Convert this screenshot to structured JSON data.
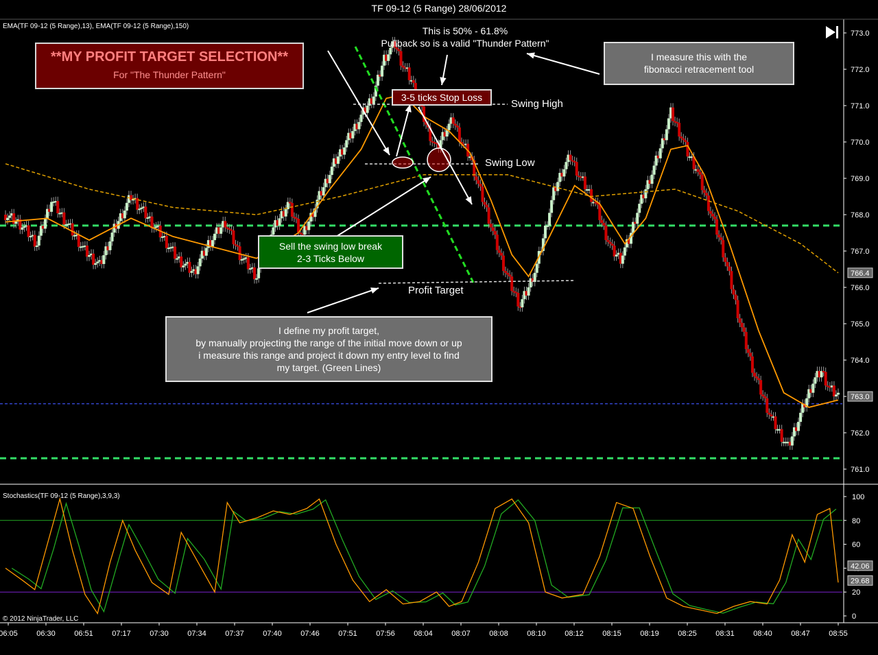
{
  "window": {
    "title": "TF 09-12 (5 Range)  28/06/2012"
  },
  "price_panel": {
    "indicator_label": "EMA(TF 09-12 (5 Range),13), EMA(TF 09-12 (5 Range),150)",
    "price_labels": [
      "773.0",
      "772.0",
      "771.0",
      "770.0",
      "769.0",
      "768.0",
      "767.0",
      "766.0",
      "765.0",
      "764.0",
      "763.0",
      "762.0",
      "761.0"
    ],
    "last_price_tag": "766.4",
    "line_price_tag": "763.0"
  },
  "stoch_panel": {
    "indicator_label": "Stochastics(TF 09-12 (5 Range),3,9,3)",
    "levels": [
      "100",
      "80",
      "60",
      "40",
      "20",
      "0"
    ],
    "tag_k": "42.06",
    "tag_d": "29.68"
  },
  "x_axis": {
    "ticks": [
      "06:05",
      "06:30",
      "06:51",
      "07:17",
      "07:30",
      "07:34",
      "07:37",
      "07:40",
      "07:46",
      "07:51",
      "07:56",
      "08:04",
      "08:07",
      "08:08",
      "08:10",
      "08:12",
      "08:15",
      "08:19",
      "08:25",
      "08:31",
      "08:40",
      "08:47",
      "08:55"
    ]
  },
  "copyright": "© 2012 NinjaTrader, LLC",
  "annotations": {
    "title_box": {
      "title": "**MY PROFIT TARGET SELECTION**",
      "subtitle": "For \"The Thunder Pattern\""
    },
    "pullback": {
      "line1": "This is 50% - 61.8%",
      "line2": "Pullback so is a valid \"Thunder Pattern\""
    },
    "fib_box": {
      "line1": "I measure this with the",
      "line2": "fibonacci retracement tool"
    },
    "stop_loss": "3-5 ticks Stop Loss",
    "swing_high": "Swing High",
    "swing_low": "Swing Low",
    "sell_box": {
      "line1": "Sell the swing low break",
      "line2": "2-3 Ticks Below"
    },
    "profit_target": "Profit Target",
    "define_box": {
      "line1": "I define my profit target,",
      "line2": "by manually projecting the range of the initial move down or up",
      "line3": "i measure this range and project it down my entry level to find",
      "line4": "my target. (Green Lines)"
    }
  },
  "colors": {
    "background": "#000000",
    "candle_up": "#c8f0c8",
    "candle_down": "#cc0000",
    "ema13": "#ff9900",
    "ema150": "#e0a000",
    "green_lines": "#33dd66",
    "blue_line": "#3344cc",
    "stoch_k": "#ff9900",
    "stoch_d": "#22aa22",
    "title_box_bg": "#6b0000",
    "sell_box_bg": "#006600",
    "grey_box_bg": "#6e6e6e"
  },
  "chart_data": {
    "type": "candlestick",
    "title": "TF 09-12 (5 Range)  28/06/2012",
    "ylim": [
      760.8,
      773.3
    ],
    "y_ticks": [
      773,
      772,
      771,
      770,
      769,
      768,
      767,
      766,
      765,
      764,
      763,
      762,
      761
    ],
    "x_ticks": [
      "06:05",
      "06:30",
      "06:51",
      "07:17",
      "07:30",
      "07:34",
      "07:37",
      "07:40",
      "07:46",
      "07:51",
      "07:56",
      "08:04",
      "08:07",
      "08:08",
      "08:10",
      "08:12",
      "08:15",
      "08:19",
      "08:25",
      "08:31",
      "08:40",
      "08:47",
      "08:55"
    ],
    "close_path": [
      [
        0,
        768.0
      ],
      [
        8,
        767.7
      ],
      [
        15,
        767.2
      ],
      [
        22,
        768.4
      ],
      [
        30,
        767.7
      ],
      [
        38,
        767.0
      ],
      [
        45,
        766.6
      ],
      [
        52,
        767.6
      ],
      [
        60,
        768.5
      ],
      [
        67,
        768.0
      ],
      [
        75,
        767.4
      ],
      [
        82,
        766.8
      ],
      [
        90,
        766.4
      ],
      [
        97,
        767.2
      ],
      [
        105,
        767.8
      ],
      [
        112,
        766.9
      ],
      [
        120,
        766.3
      ],
      [
        127,
        767.5
      ],
      [
        135,
        768.3
      ],
      [
        142,
        767.4
      ],
      [
        150,
        768.5
      ],
      [
        157,
        769.4
      ],
      [
        164,
        770.1
      ],
      [
        170,
        770.7
      ],
      [
        176,
        771.3
      ],
      [
        181,
        772.3
      ],
      [
        186,
        772.7
      ],
      [
        190,
        772.1
      ],
      [
        194,
        771.7
      ],
      [
        198,
        771.0
      ],
      [
        202,
        770.3
      ],
      [
        206,
        769.8
      ],
      [
        210,
        770.3
      ],
      [
        214,
        770.6
      ],
      [
        218,
        770.0
      ],
      [
        222,
        769.6
      ],
      [
        226,
        768.8
      ],
      [
        230,
        768.1
      ],
      [
        234,
        767.3
      ],
      [
        238,
        766.6
      ],
      [
        242,
        766.0
      ],
      [
        246,
        765.5
      ],
      [
        250,
        766.0
      ],
      [
        254,
        766.6
      ],
      [
        258,
        767.6
      ],
      [
        262,
        768.6
      ],
      [
        266,
        769.2
      ],
      [
        270,
        769.6
      ],
      [
        274,
        769.1
      ],
      [
        278,
        768.7
      ],
      [
        282,
        768.3
      ],
      [
        286,
        767.6
      ],
      [
        290,
        767.0
      ],
      [
        294,
        766.8
      ],
      [
        298,
        767.3
      ],
      [
        302,
        768.1
      ],
      [
        306,
        768.7
      ],
      [
        310,
        769.3
      ],
      [
        314,
        770.0
      ],
      [
        318,
        770.8
      ],
      [
        322,
        770.3
      ],
      [
        326,
        769.7
      ],
      [
        330,
        769.3
      ],
      [
        334,
        768.6
      ],
      [
        338,
        767.9
      ],
      [
        342,
        767.2
      ],
      [
        346,
        766.3
      ],
      [
        350,
        765.3
      ],
      [
        354,
        764.4
      ],
      [
        358,
        763.6
      ],
      [
        362,
        763.0
      ],
      [
        366,
        762.4
      ],
      [
        370,
        762.0
      ],
      [
        374,
        761.6
      ],
      [
        378,
        762.2
      ],
      [
        382,
        762.8
      ],
      [
        386,
        763.4
      ],
      [
        390,
        763.7
      ],
      [
        394,
        763.2
      ],
      [
        398,
        763.0
      ]
    ],
    "ema13_path": [
      [
        0,
        767.8
      ],
      [
        20,
        767.9
      ],
      [
        40,
        767.3
      ],
      [
        60,
        767.9
      ],
      [
        80,
        767.4
      ],
      [
        100,
        767.1
      ],
      [
        120,
        766.8
      ],
      [
        140,
        767.5
      ],
      [
        155,
        768.7
      ],
      [
        170,
        769.8
      ],
      [
        182,
        771.2
      ],
      [
        190,
        771.3
      ],
      [
        200,
        770.7
      ],
      [
        212,
        770.3
      ],
      [
        222,
        769.7
      ],
      [
        232,
        768.4
      ],
      [
        242,
        766.9
      ],
      [
        250,
        766.3
      ],
      [
        260,
        767.4
      ],
      [
        272,
        768.8
      ],
      [
        284,
        768.3
      ],
      [
        296,
        767.2
      ],
      [
        306,
        767.9
      ],
      [
        318,
        769.8
      ],
      [
        326,
        769.9
      ],
      [
        334,
        769.1
      ],
      [
        346,
        767.2
      ],
      [
        360,
        764.8
      ],
      [
        372,
        763.1
      ],
      [
        384,
        762.7
      ],
      [
        398,
        762.9
      ]
    ],
    "ema150_path": [
      [
        0,
        769.4
      ],
      [
        40,
        768.7
      ],
      [
        80,
        768.2
      ],
      [
        120,
        768.0
      ],
      [
        160,
        768.5
      ],
      [
        200,
        769.1
      ],
      [
        240,
        769.1
      ],
      [
        280,
        768.5
      ],
      [
        320,
        768.7
      ],
      [
        350,
        768.1
      ],
      [
        380,
        767.2
      ],
      [
        398,
        766.4
      ]
    ],
    "series": [
      {
        "name": "EMA(TF 09-12 (5 Range),13)",
        "values_note": ""
      },
      {
        "name": "EMA(TF 09-12 (5 Range),150)",
        "values_note": ""
      }
    ],
    "horizontal_lines": [
      {
        "price": 767.7,
        "color": "#33dd66",
        "style": "dashed"
      },
      {
        "price": 761.3,
        "color": "#33dd66",
        "style": "dashed"
      },
      {
        "price": 762.8,
        "color": "#3344cc",
        "style": "dashed"
      }
    ],
    "stochastics": {
      "levels": [
        0,
        20,
        40,
        60,
        80,
        100
      ],
      "guides": [
        20,
        80
      ],
      "k_path": [
        [
          0,
          40
        ],
        [
          8,
          30
        ],
        [
          14,
          22
        ],
        [
          20,
          60
        ],
        [
          26,
          98
        ],
        [
          32,
          55
        ],
        [
          38,
          18
        ],
        [
          44,
          2
        ],
        [
          50,
          45
        ],
        [
          56,
          80
        ],
        [
          62,
          55
        ],
        [
          70,
          28
        ],
        [
          78,
          18
        ],
        [
          84,
          70
        ],
        [
          92,
          45
        ],
        [
          100,
          20
        ],
        [
          106,
          95
        ],
        [
          112,
          78
        ],
        [
          120,
          82
        ],
        [
          128,
          88
        ],
        [
          136,
          85
        ],
        [
          144,
          90
        ],
        [
          150,
          98
        ],
        [
          158,
          60
        ],
        [
          166,
          30
        ],
        [
          174,
          12
        ],
        [
          182,
          22
        ],
        [
          190,
          10
        ],
        [
          198,
          12
        ],
        [
          206,
          20
        ],
        [
          212,
          8
        ],
        [
          218,
          12
        ],
        [
          226,
          45
        ],
        [
          234,
          90
        ],
        [
          242,
          98
        ],
        [
          250,
          78
        ],
        [
          258,
          20
        ],
        [
          266,
          15
        ],
        [
          276,
          18
        ],
        [
          284,
          50
        ],
        [
          292,
          95
        ],
        [
          300,
          90
        ],
        [
          308,
          50
        ],
        [
          316,
          15
        ],
        [
          324,
          8
        ],
        [
          332,
          5
        ],
        [
          340,
          2
        ],
        [
          348,
          8
        ],
        [
          356,
          12
        ],
        [
          364,
          10
        ],
        [
          370,
          30
        ],
        [
          376,
          68
        ],
        [
          382,
          45
        ],
        [
          388,
          85
        ],
        [
          394,
          90
        ],
        [
          398,
          28
        ]
      ],
      "k_tag": 42.06,
      "d_tag": 29.68
    }
  }
}
